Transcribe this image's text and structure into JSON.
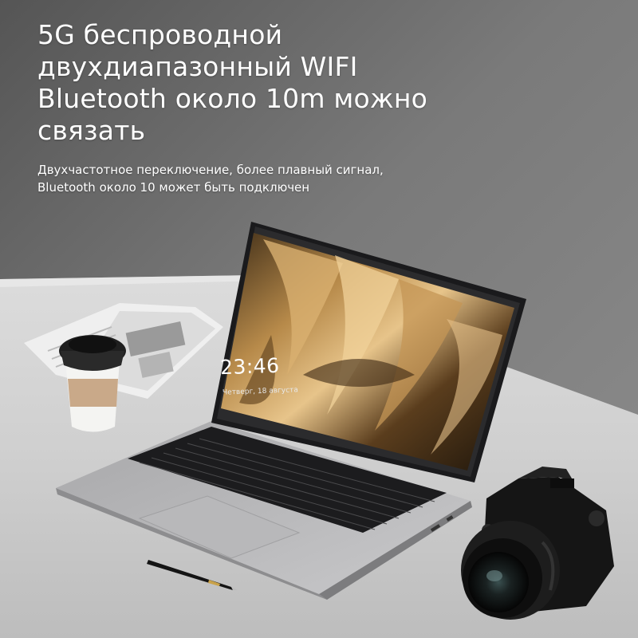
{
  "headline": {
    "line1": "5G беспроводной",
    "line2": "двухдиапазонный WIFI",
    "line3": "Bluetooth около 10m можно",
    "line4": "связать"
  },
  "subheadline": {
    "line1": "Двухчастотное переключение, более плавный сигнал,",
    "line2": "Bluetooth около 10 может быть подключен"
  },
  "laptop_screen": {
    "time": "23:46",
    "date": "Четверг, 18 августа"
  }
}
